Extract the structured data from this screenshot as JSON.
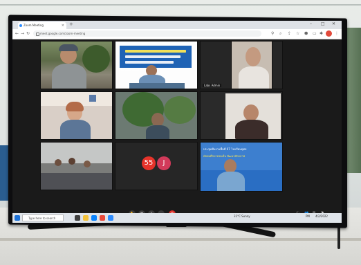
{
  "browser": {
    "tab_title": "Zoom Meeting",
    "url": "meet.google.com/zoom-meeting",
    "new_tab": "+",
    "win_min": "–",
    "win_max": "□",
    "win_close": "✕"
  },
  "tiles": [
    {
      "id": "t1",
      "name": "",
      "color": "#6b7a55"
    },
    {
      "id": "t2",
      "name": "",
      "color": "#ffffff"
    },
    {
      "id": "t3",
      "name": "Labs Admin",
      "color": "#2b2b2b"
    },
    {
      "id": "t4",
      "name": "",
      "color": "#caa89a"
    },
    {
      "id": "t5",
      "name": "",
      "color": "#5e6b6e"
    },
    {
      "id": "t6",
      "name": "",
      "color": "#d9d4cc"
    },
    {
      "id": "t7",
      "name": "",
      "color": "#6c6d6e"
    },
    {
      "id": "t8",
      "name": "",
      "color": "#2b2b2b"
    },
    {
      "id": "t9",
      "name": "",
      "color": "#1f66b8"
    }
  ],
  "banners": {
    "left_thai": "โครงการพัฒนาพื้นที่ 10 โรงเรียนพุทธ",
    "right_thai_1": "ประชุมทีมงานพื้นที่ 07 โรงเรียนพุทธ",
    "right_thai_2": "มัธยมศึกษาตอนต้น พัฒนาศักยภาพ"
  },
  "avatars": [
    {
      "label": "55",
      "color": "#e6332a"
    },
    {
      "label": "J",
      "color": "#d23a5a"
    }
  ],
  "taskbar": {
    "search_placeholder": "Type here to search",
    "weather": "31°C Sunny",
    "time": "PM",
    "date": "4/2/2022"
  },
  "tv_brand": "SAMSUNG",
  "colors": {
    "zoom_bg": "#1a1a1a",
    "end_call": "#e0332c",
    "taskbar": "#dfe4ea"
  }
}
